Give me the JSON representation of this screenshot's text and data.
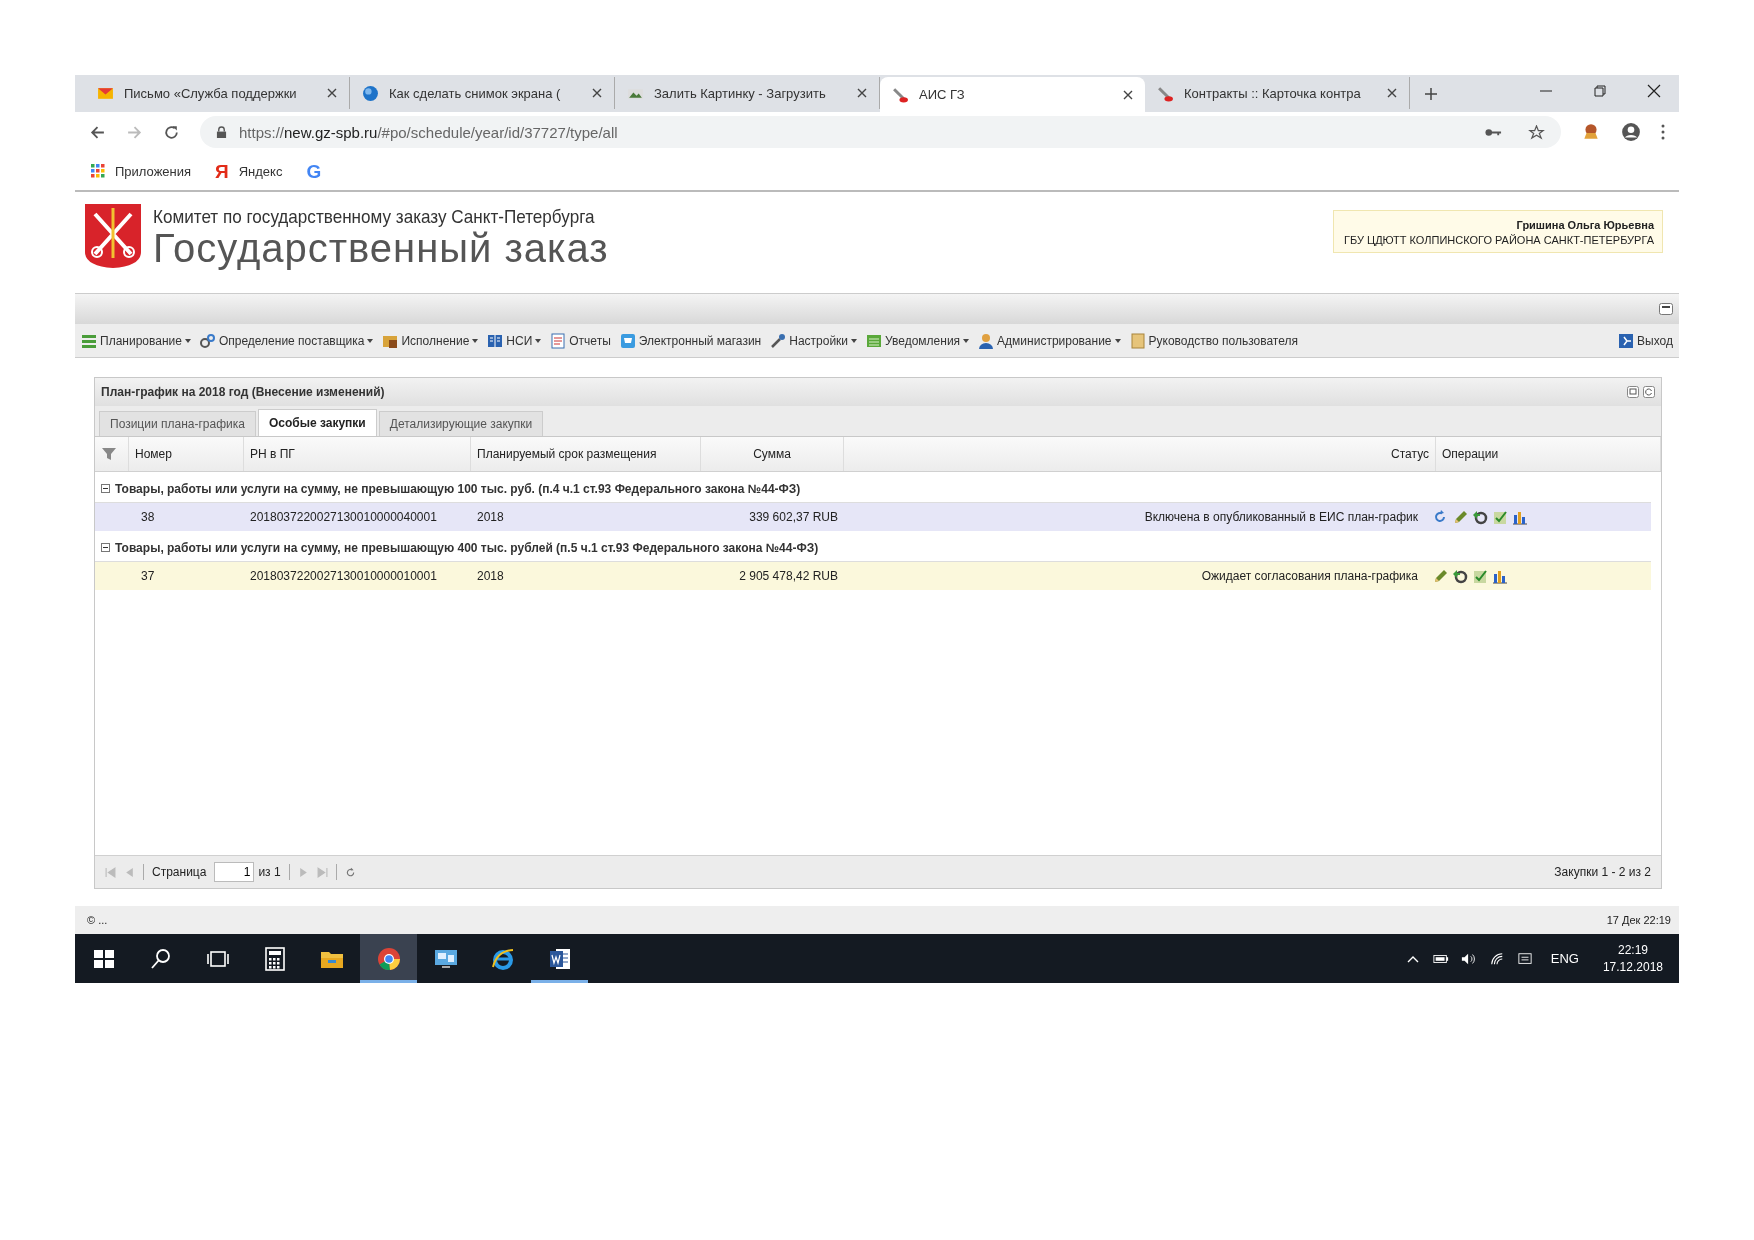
{
  "browser": {
    "tabs": [
      {
        "kind": "mail",
        "title": "Письмо «Служба поддержки",
        "selected": false
      },
      {
        "kind": "help",
        "title": "Как сделать снимок экрана (",
        "selected": false
      },
      {
        "kind": "image",
        "title": "Залить Картинку - Загрузить",
        "selected": false
      },
      {
        "kind": "tool",
        "title": "АИС ГЗ",
        "selected": true
      },
      {
        "kind": "tool",
        "title": "Контракты :: Карточка контра",
        "selected": false
      }
    ],
    "address": {
      "scheme": "https://",
      "host": "new.gz-spb.ru",
      "path": "/#po/schedule/year/id/37727/type/all"
    },
    "bookmarks": [
      {
        "kind": "apps",
        "label": "Приложения"
      },
      {
        "kind": "letter",
        "mark": "Я",
        "color": "#e22b18",
        "label": "Яндекс"
      },
      {
        "kind": "letter",
        "mark": "G",
        "color": "#4285f4"
      }
    ]
  },
  "header": {
    "org": "Комитет по государственному заказу Санкт-Петербурга",
    "title": "Государственный заказ",
    "user": {
      "name": "Гришина Ольга Юрьевна",
      "organization": "ГБУ ЦДЮТТ КОЛПИНСКОГО РАЙОНА САНКТ-ПЕТЕРБУРГА"
    }
  },
  "menu": {
    "items": [
      {
        "kind": "plan",
        "label": "Планирование",
        "dropdown": true
      },
      {
        "kind": "gears",
        "label": "Определение поставщика",
        "dropdown": true
      },
      {
        "kind": "exec",
        "label": "Исполнение",
        "dropdown": true
      },
      {
        "kind": "book",
        "label": "НСИ",
        "dropdown": true
      },
      {
        "kind": "report",
        "label": "Отчеты",
        "dropdown": false
      },
      {
        "kind": "cart",
        "label": "Электронный магазин",
        "dropdown": false
      },
      {
        "kind": "wrench",
        "label": "Настройки",
        "dropdown": true
      },
      {
        "kind": "list",
        "label": "Уведомления",
        "dropdown": true
      },
      {
        "kind": "user",
        "label": "Администрирование",
        "dropdown": true
      },
      {
        "kind": "manual",
        "label": "Руководство пользователя",
        "dropdown": false
      }
    ],
    "exit": "Выход"
  },
  "panel": {
    "title": "План-график на 2018 год (Внесение изменений)",
    "tabs": [
      {
        "label": "Позиции плана-графика",
        "selected": false
      },
      {
        "label": "Особые закупки",
        "selected": true
      },
      {
        "label": "Детализирующие закупки",
        "selected": false
      }
    ],
    "columns": [
      "Номер",
      "РН в ПГ",
      "Планируемый срок размещения",
      "Сумма",
      "Статус",
      "Операции"
    ],
    "groups": [
      {
        "title": "Товары, работы или услуги на сумму, не превышающую 100 тыс. руб. (п.4 ч.1 ст.93 Федерального закона №44-ФЗ)",
        "expanded": true,
        "children": [
          {
            "number": "38",
            "registry": "2018037220027130010000040001",
            "term": "2018",
            "sum": "339 602,37 RUB",
            "status": "Включена в опубликованный в ЕИС план-график",
            "color": "#e6e6f7",
            "operations": [
              {
                "kind": "refresh"
              },
              {
                "kind": "edit"
              },
              {
                "kind": "gear"
              },
              {
                "kind": "approve"
              },
              {
                "kind": "chart"
              }
            ]
          }
        ]
      },
      {
        "title": "Товары, работы или услуги на сумму, не превышающую 400 тыс. рублей (п.5 ч.1 ст.93 Федерального закона №44-ФЗ)",
        "expanded": true,
        "children": [
          {
            "number": "37",
            "registry": "2018037220027130010000010001",
            "term": "2018",
            "sum": "2 905 478,42 RUB",
            "status": "Ожидает согласования плана-графика",
            "color": "#fbf8dc",
            "operations": [
              {
                "kind": "edit"
              },
              {
                "kind": "gear"
              },
              {
                "kind": "approve"
              },
              {
                "kind": "chart"
              }
            ]
          }
        ]
      }
    ],
    "pager": {
      "page_label": "Страница",
      "page": "1",
      "of": "из 1",
      "summary": "Закупки 1 - 2 из 2"
    }
  },
  "status_bar": {
    "left": "© ...",
    "right": "17 Дек 22:19"
  },
  "taskbar": {
    "apps": [
      {
        "kind": "start",
        "running": false,
        "selected": false
      },
      {
        "kind": "search",
        "running": false,
        "selected": false
      },
      {
        "kind": "taskview",
        "running": false,
        "selected": false
      },
      {
        "kind": "calculator",
        "running": false,
        "selected": false
      },
      {
        "kind": "folder",
        "running": false,
        "selected": false
      },
      {
        "kind": "chrome",
        "running": true,
        "selected": true
      },
      {
        "kind": "monitor",
        "running": false,
        "selected": false
      },
      {
        "kind": "ie",
        "running": false,
        "selected": false
      },
      {
        "kind": "word",
        "running": true,
        "selected": false
      }
    ],
    "language": "ENG",
    "time": "22:19",
    "date": "17.12.2018"
  }
}
